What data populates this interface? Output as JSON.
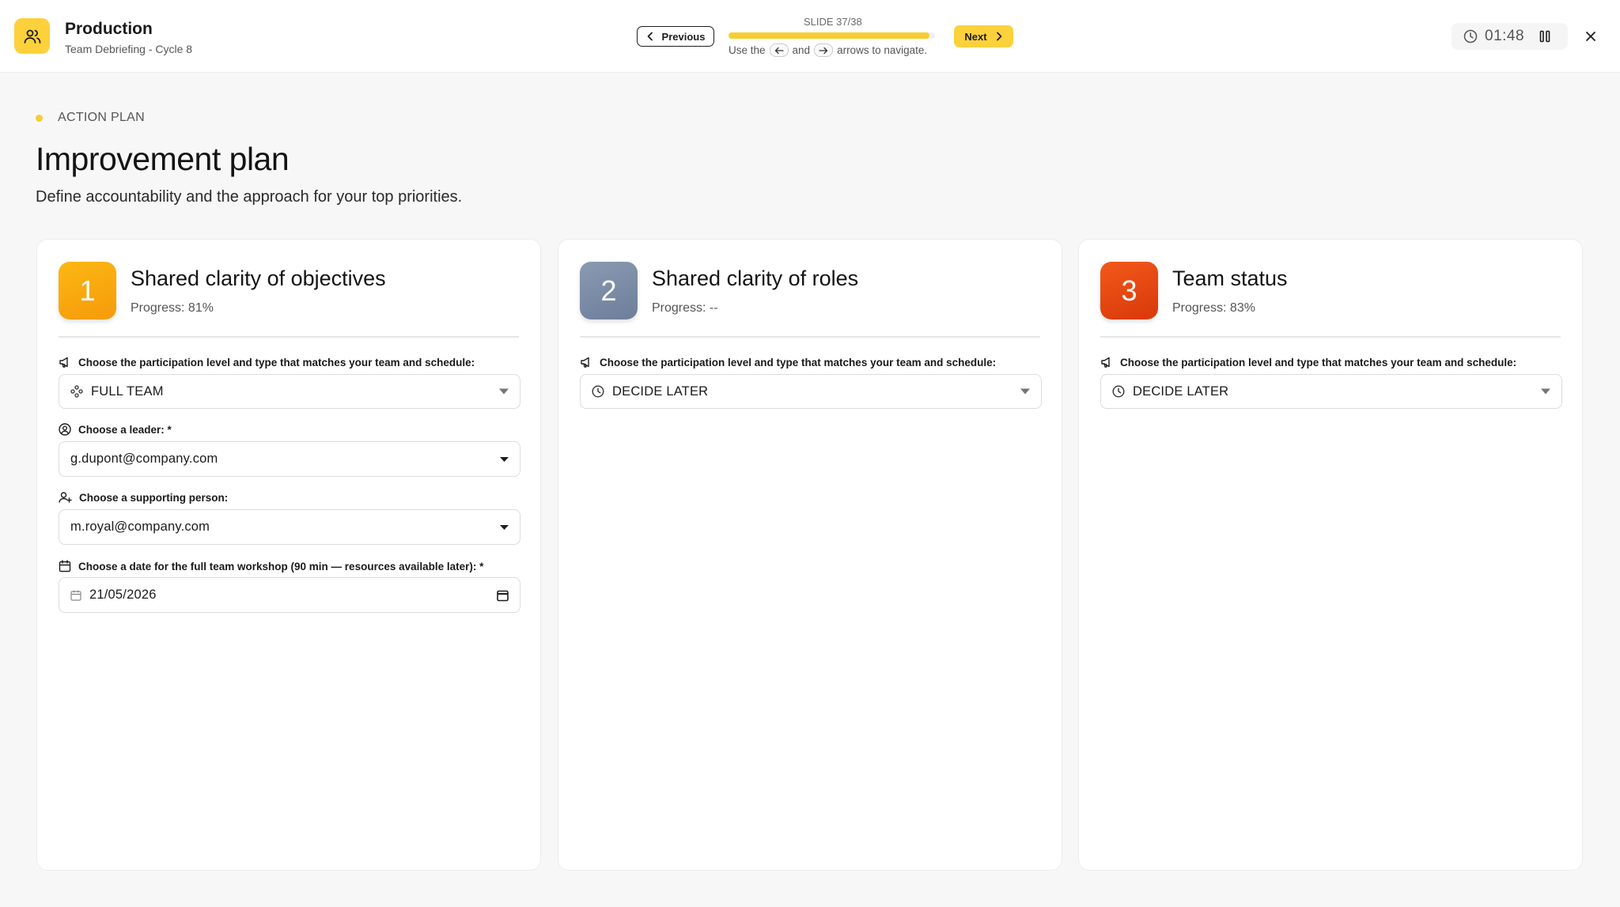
{
  "header": {
    "app_title": "Production",
    "app_subtitle": "Team Debriefing - Cycle 8",
    "accent_color": "#fcd13b"
  },
  "navigation": {
    "previous_label": "Previous",
    "next_label": "Next",
    "slide_counter": "SLIDE 37/38",
    "progress_fraction": 0.9737,
    "hint_prefix": "Use the",
    "hint_and": "and",
    "hint_suffix": "arrows to navigate."
  },
  "timer": {
    "time": "01:48"
  },
  "section": {
    "label": "ACTION PLAN",
    "title": "Improvement plan",
    "description": "Define accountability and the approach for your top priorities."
  },
  "cards": [
    {
      "number": "1",
      "title": "Shared clarity of objectives",
      "progress": "Progress: 81%",
      "badge_colors": [
        "#fcb813",
        "#f59a0a"
      ],
      "participation_label": "Choose the participation level and type that matches your team and schedule:",
      "participation_value": "FULL TEAM",
      "participation_icon": "team-nodes-icon",
      "leader_label": "Choose a leader: *",
      "leader_value": "g.dupont@company.com",
      "support_label": "Choose a supporting person:",
      "support_value": "m.royal@company.com",
      "date_label": "Choose a date for the full team workshop (90 min — resources available later): *",
      "date_value": "21/05/2026"
    },
    {
      "number": "2",
      "title": "Shared clarity of roles",
      "progress": "Progress: --",
      "badge_colors": [
        "#8a9ab3",
        "#6d7e99"
      ],
      "participation_label": "Choose the participation level and type that matches your team and schedule:",
      "participation_value": "DECIDE LATER",
      "participation_icon": "clock-icon"
    },
    {
      "number": "3",
      "title": "Team status",
      "progress": "Progress: 83%",
      "badge_colors": [
        "#f2591a",
        "#d9380a"
      ],
      "participation_label": "Choose the participation level and type that matches your team and schedule:",
      "participation_value": "DECIDE LATER",
      "participation_icon": "clock-icon"
    }
  ]
}
